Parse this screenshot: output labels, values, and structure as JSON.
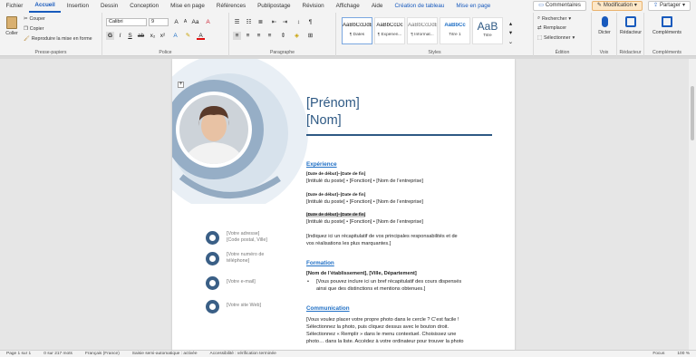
{
  "tabs": [
    "Fichier",
    "Accueil",
    "Insertion",
    "Dessin",
    "Conception",
    "Mise en page",
    "Références",
    "Publipostage",
    "Révision",
    "Affichage",
    "Aide",
    "Création de tableau",
    "Mise en page"
  ],
  "active_tab": "Accueil",
  "top_right": {
    "comments": "Commentaires",
    "editing": "Modification",
    "share": "Partager"
  },
  "clipboard": {
    "paste": "Coller",
    "cut": "Couper",
    "copy": "Copier",
    "format_painter": "Reproduire la mise en forme",
    "label": "Presse-papiers"
  },
  "font": {
    "name": "Calibri",
    "size": "9",
    "label": "Police"
  },
  "paragraph": {
    "label": "Paragraphe"
  },
  "styles": {
    "label": "Styles",
    "items": [
      {
        "preview": "AaBbCcDdE",
        "name": "¶ Dates"
      },
      {
        "preview": "AaBbCcDc",
        "name": "¶ Expérien..."
      },
      {
        "preview": "AaBbCcDdE",
        "name": "¶ Informat..."
      },
      {
        "preview": "AaBbCc",
        "name": "Titre 1"
      },
      {
        "preview": "AaB",
        "name": "Titre"
      }
    ]
  },
  "editing_group": {
    "find": "Rechercher",
    "replace": "Remplacer",
    "select": "Sélectionner",
    "label": "Édition"
  },
  "voice": {
    "dictate": "Dicter",
    "label": "Voix"
  },
  "editor": {
    "button": "Rédacteur",
    "label": "Rédacteur"
  },
  "addins": {
    "button": "Compléments",
    "label": "Compléments"
  },
  "cv": {
    "first_name": "[Prénom]",
    "last_name": "[Nom]",
    "experience_title": "Expérience",
    "jobs": [
      {
        "dates": "[Date de début]–[Date de fin]",
        "detail": "[Intitulé du poste] • [Fonction] • [Nom de l’entreprise]"
      },
      {
        "dates": "[Date de début]–[Date de fin]",
        "detail": "[Intitulé du poste] • [Fonction] • [Nom de l’entreprise]"
      },
      {
        "dates": "[Date de début]–[Date de fin]",
        "detail": "[Intitulé du poste] • [Fonction] • [Nom de l’entreprise]"
      }
    ],
    "summary_1": "[Indiquez ici un récapitulatif de vos principales responsabilités et de",
    "summary_2": "vos réalisations les plus marquantes.]",
    "education_title": "Formation",
    "school": "[Nom de l’établissement], [Ville, Département]",
    "edu_1": "[Vous pouvez inclure ici un bref récapitulatif des cours dispensés",
    "edu_2": "ainsi que des distinctions et mentions obtenues.]",
    "comm_title": "Communication",
    "comm_1": "[Vous voulez placer votre propre photo dans le cercle ? C’est facile !",
    "comm_2": "Sélectionnez la photo, puis cliquez dessus avec le bouton droit.",
    "comm_3": "Sélectionnez « Remplir » dans le menu contextuel. Choisissez une",
    "comm_4": "photo… dans la liste. Accédez à votre ordinateur pour trouver la photo",
    "address_1": "[Votre adresse]",
    "address_2": "[Code postal, Ville]",
    "phone_1": "[Votre numéro de",
    "phone_2": "téléphone]",
    "email": "[Votre e-mail]",
    "website": "[Votre site Web]"
  },
  "status": {
    "page": "Page 1 sur 1",
    "words": "0 sur 217 mots",
    "lang": "Français (France)",
    "autocomplete": "Saisie semi-automatique : activée",
    "access": "Accessibilité : vérification terminée",
    "focus": "Focus",
    "zoom": "100 %"
  },
  "colors": {
    "accent": "#185abd",
    "name": "#2e5984",
    "section": "#1f6fc5",
    "icon_circle": "#3a5f86"
  }
}
